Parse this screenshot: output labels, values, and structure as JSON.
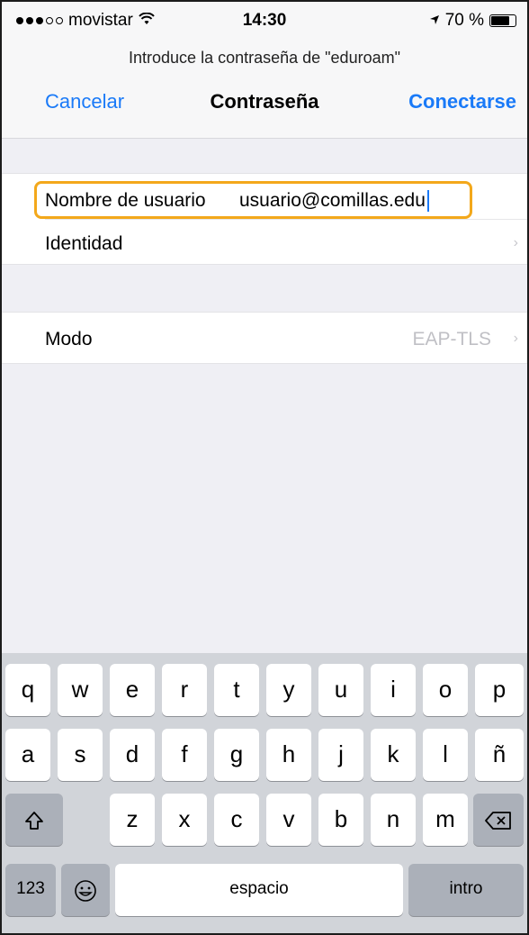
{
  "status_bar": {
    "carrier": "movistar",
    "time": "14:30",
    "battery": "70 %",
    "battery_level": 0.7,
    "signal_bars_filled": 3,
    "signal_bars_total": 5
  },
  "dialog": {
    "prompt": "Introduce la contraseña de \"eduroam\"",
    "cancel_label": "Cancelar",
    "title": "Contraseña",
    "connect_label": "Conectarse"
  },
  "form": {
    "username_label": "Nombre de usuario",
    "username_value": "usuario@comillas.edu",
    "identity_label": "Identidad",
    "mode_label": "Modo",
    "mode_value": "EAP-TLS"
  },
  "keyboard": {
    "row1": [
      "q",
      "w",
      "e",
      "r",
      "t",
      "y",
      "u",
      "i",
      "o",
      "p"
    ],
    "row2": [
      "a",
      "s",
      "d",
      "f",
      "g",
      "h",
      "j",
      "k",
      "l",
      "ñ"
    ],
    "row3": [
      "z",
      "x",
      "c",
      "v",
      "b",
      "n",
      "m"
    ],
    "numbers_label": "123",
    "space_label": "espacio",
    "return_label": "intro"
  },
  "colors": {
    "accent": "#1a7af8",
    "highlight_border": "#f3a81b"
  }
}
